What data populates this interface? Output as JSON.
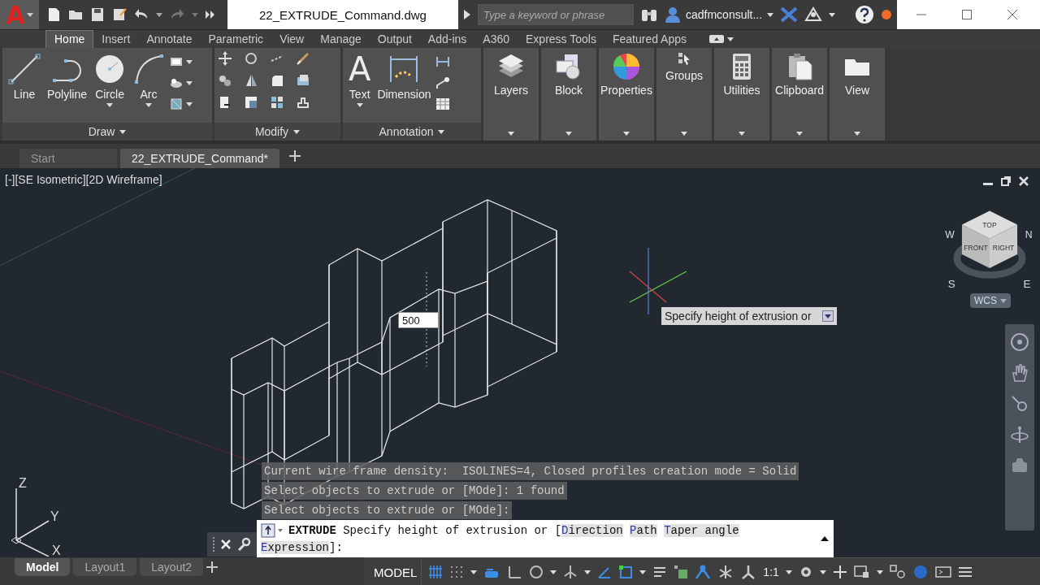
{
  "title_bar": {
    "app_button": "A",
    "file_name": "22_EXTRUDE_Command.dwg",
    "search": {
      "placeholder": "Type a keyword or phrase"
    },
    "user": "cadfmconsult..."
  },
  "ribbon": {
    "tabs": [
      {
        "label": "Home",
        "selected": true
      },
      {
        "label": "Insert",
        "selected": false
      },
      {
        "label": "Annotate",
        "selected": false
      },
      {
        "label": "Parametric",
        "selected": false
      },
      {
        "label": "View",
        "selected": false
      },
      {
        "label": "Manage",
        "selected": false
      },
      {
        "label": "Output",
        "selected": false
      },
      {
        "label": "Add-ins",
        "selected": false
      },
      {
        "label": "A360",
        "selected": false
      },
      {
        "label": "Express Tools",
        "selected": false
      },
      {
        "label": "Featured Apps",
        "selected": false
      }
    ],
    "panels": [
      {
        "kind": "draw",
        "title": "Draw",
        "tools": [
          {
            "label": "Line",
            "dropdown": false
          },
          {
            "label": "Polyline",
            "dropdown": false
          },
          {
            "label": "Circle",
            "dropdown": true
          },
          {
            "label": "Arc",
            "dropdown": true
          }
        ]
      },
      {
        "kind": "modify",
        "title": "Modify"
      },
      {
        "kind": "annotation",
        "title": "Annotation",
        "tools": [
          {
            "label": "Text",
            "glyph": "A",
            "dropdown": true
          },
          {
            "label": "Dimension",
            "dropdown": false
          }
        ]
      },
      {
        "kind": "single",
        "title": "Layers"
      },
      {
        "kind": "single",
        "title": "Block"
      },
      {
        "kind": "single",
        "title": "Properties"
      },
      {
        "kind": "single",
        "title": "Groups"
      },
      {
        "kind": "single",
        "title": "Utilities"
      },
      {
        "kind": "single",
        "title": "Clipboard"
      },
      {
        "kind": "single",
        "title": "View"
      }
    ]
  },
  "doc_tabs": [
    {
      "label": "Start",
      "selected": false
    },
    {
      "label": "22_EXTRUDE_Command*",
      "selected": true
    }
  ],
  "viewport": {
    "label": "[-][SE Isometric][2D Wireframe]",
    "dynamic_input": "500",
    "tooltip": "Specify height of extrusion or",
    "viewcube": {
      "faces": [
        "TOP",
        "FRONT",
        "RIGHT"
      ],
      "compass": [
        "W",
        "N",
        "S",
        "E"
      ],
      "ucs_menu": "WCS"
    },
    "ucs_axes": [
      "Z",
      "Y",
      "X"
    ]
  },
  "command_line": {
    "history": [
      "Current wire frame density:  ISOLINES=4, Closed profiles creation mode = Solid",
      "Select objects to extrude or [MOde]: 1 found",
      "Select objects to extrude or [MOde]:"
    ],
    "command": "EXTRUDE",
    "prompt": "Specify height of extrusion or [",
    "options": [
      "Direction",
      "Path",
      "Taper angle",
      "Expression"
    ],
    "suffix": "]:"
  },
  "layout_tabs": [
    {
      "label": "Model",
      "selected": true
    },
    {
      "label": "Layout1",
      "selected": false
    },
    {
      "label": "Layout2",
      "selected": false
    }
  ],
  "status_bar": {
    "space": "MODEL",
    "scale": "1:1"
  }
}
